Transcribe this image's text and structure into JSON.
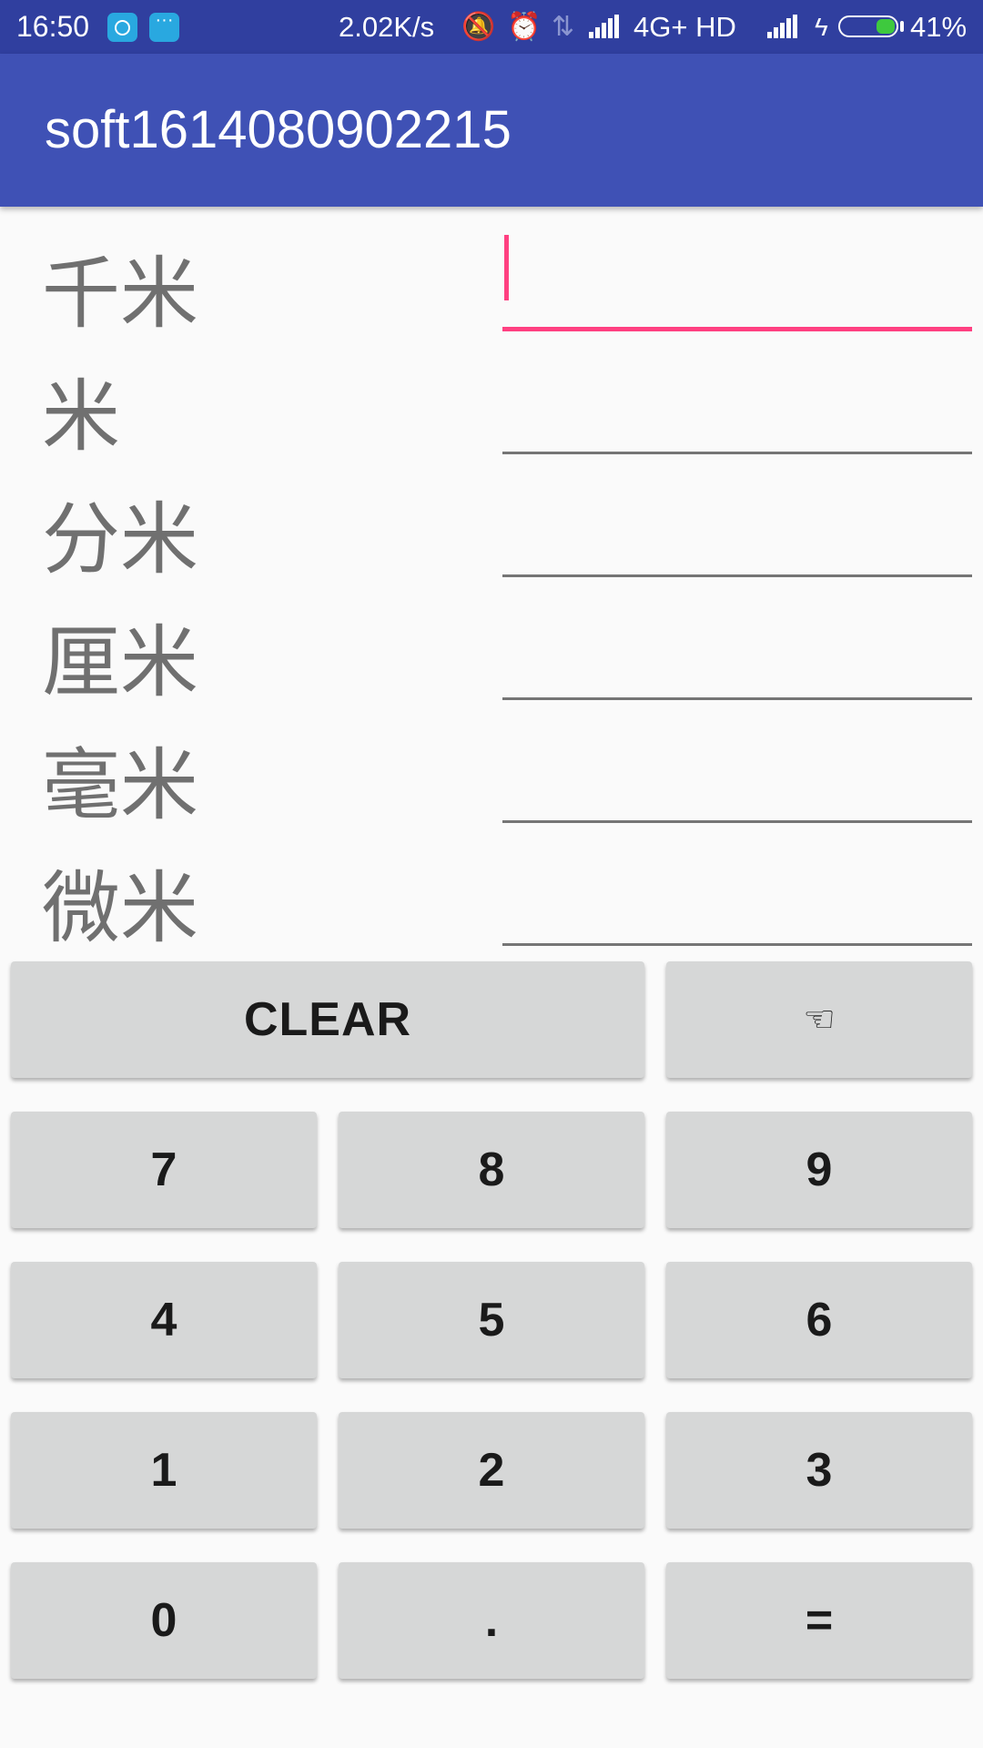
{
  "status_bar": {
    "time": "16:50",
    "speed": "2.02K/s",
    "network": "4G+ HD",
    "battery_percent": "41%",
    "battery_level": 0.41,
    "icons": [
      "k-app-icon",
      "chat-app-icon",
      "mute-icon",
      "alarm-icon",
      "data-arrows-icon",
      "signal-icon",
      "signal-icon-2",
      "charging-icon"
    ]
  },
  "app_bar": {
    "title": "soft1614080902215",
    "color": "#3f51b5"
  },
  "units": [
    {
      "label": "千米",
      "value": ""
    },
    {
      "label": "米",
      "value": ""
    },
    {
      "label": "分米",
      "value": ""
    },
    {
      "label": "厘米",
      "value": ""
    },
    {
      "label": "毫米",
      "value": ""
    },
    {
      "label": "微米",
      "value": ""
    }
  ],
  "keypad": {
    "clear": "CLEAR",
    "hand": "☜",
    "rows": [
      [
        "7",
        "8",
        "9"
      ],
      [
        "4",
        "5",
        "6"
      ],
      [
        "1",
        "2",
        "3"
      ],
      [
        "0",
        ".",
        "="
      ]
    ]
  },
  "colors": {
    "accent": "#ff4081",
    "status_bar": "#303f9f"
  }
}
